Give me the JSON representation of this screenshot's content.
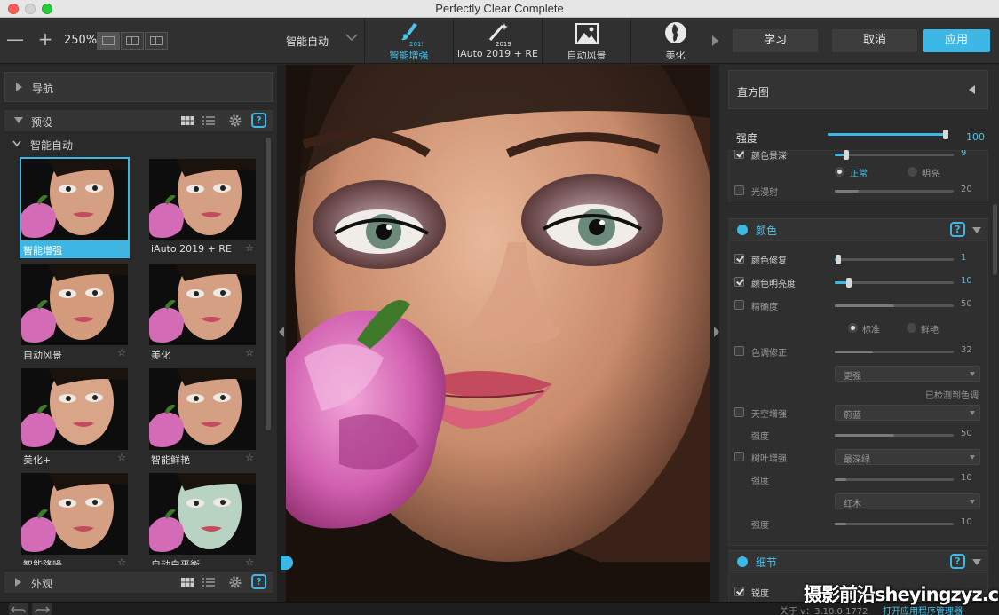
{
  "window": {
    "title": "Perfectly Clear Complete"
  },
  "toolbar": {
    "zoom_out": "—",
    "zoom_in": "+",
    "zoom": "250%",
    "preset_select": "智能自动",
    "tabs": [
      {
        "label": "智能增强",
        "active": true,
        "icon": "brush-2019-icon"
      },
      {
        "label": "iAuto 2019 + RE",
        "active": false,
        "icon": "magic-wand-2019-icon"
      },
      {
        "label": "自动风景",
        "active": false,
        "icon": "landscape-icon"
      },
      {
        "label": "美化",
        "active": false,
        "icon": "face-profile-icon"
      }
    ],
    "learn": "学习",
    "cancel": "取消",
    "apply": "应用"
  },
  "left": {
    "navigation": "导航",
    "presets": "预设",
    "category": "智能自动",
    "help": "?",
    "thumbs": [
      {
        "label": "智能增强",
        "selected": true,
        "star": "☆"
      },
      {
        "label": "iAuto 2019 + RE",
        "selected": false,
        "star": "☆"
      },
      {
        "label": "自动风景",
        "selected": false,
        "star": "☆"
      },
      {
        "label": "美化",
        "selected": false,
        "star": "☆"
      },
      {
        "label": "美化+",
        "selected": false,
        "star": "☆"
      },
      {
        "label": "智能鲜艳",
        "selected": false,
        "star": "☆"
      },
      {
        "label": "智能降噪",
        "selected": false,
        "star": "☆"
      },
      {
        "label": "自动白平衡",
        "selected": false,
        "star": "☆"
      }
    ],
    "looks": "外观"
  },
  "right": {
    "histogram": "直方图",
    "strength": {
      "label": "强度",
      "value": "100",
      "level": 0.99
    },
    "tone": {
      "depth": {
        "label": "颜色景深",
        "value": "9",
        "level": 0.1
      },
      "radio": [
        {
          "label": "正常",
          "on": true
        },
        {
          "label": "明亮",
          "on": false
        }
      ],
      "glow": {
        "label": "光漫射",
        "value": "20",
        "level": 0.2
      }
    },
    "color_section": "颜色",
    "color": {
      "fix": {
        "label": "颜色修复",
        "value": "1",
        "level": 0.03
      },
      "vibrancy": {
        "label": "颜色明亮度",
        "value": "10",
        "level": 0.12
      },
      "accuracy": {
        "label": "精确度",
        "value": "50",
        "level": 0.5
      },
      "accuracy_radio": [
        {
          "label": "标准",
          "on": true
        },
        {
          "label": "鲜艳",
          "on": false
        }
      ],
      "tint": {
        "label": "色调修正",
        "value": "32",
        "level": 0.32
      },
      "tint_mode": "更强",
      "tint_note": "已检测到色调",
      "sky": {
        "label": "天空增强",
        "mode": "蔚蓝"
      },
      "sky_strength": {
        "label": "强度",
        "value": "50",
        "level": 0.5
      },
      "foliage": {
        "label": "树叶增强",
        "mode": "最深绿"
      },
      "foliage_strength": {
        "label": "强度",
        "value": "10",
        "level": 0.1
      },
      "wood_mode": "红木",
      "wood_strength": {
        "label": "强度",
        "value": "10",
        "level": 0.1
      }
    },
    "detail_section": "细节",
    "detail": {
      "sharpen": {
        "label": "锐度"
      }
    }
  },
  "status": {
    "about": "关于 v：3.10.0.1772",
    "open_manager": "打开应用程序管理器"
  },
  "watermark": "摄影前沿sheyingzyz.com",
  "colors": {
    "accent": "#3db8e6",
    "bg": "#262626",
    "panel": "#2b2b2b"
  }
}
